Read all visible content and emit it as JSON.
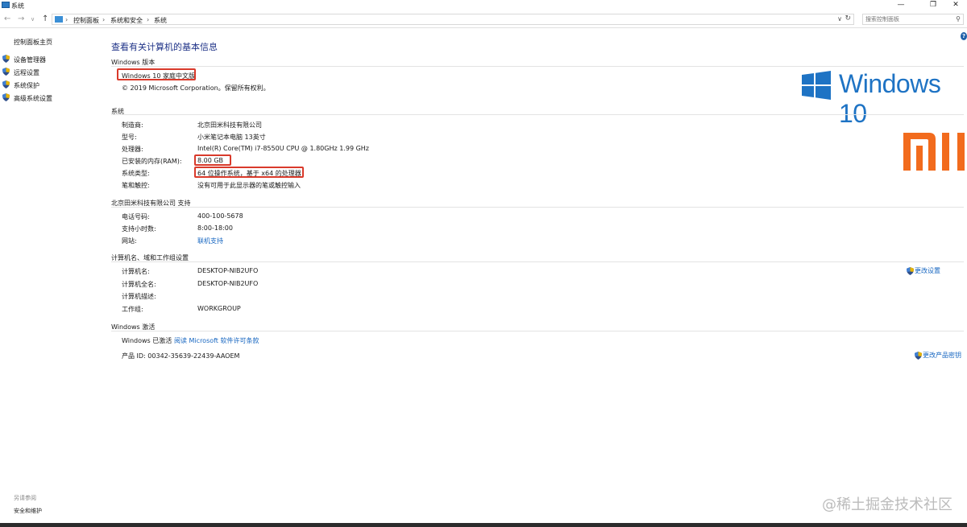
{
  "window": {
    "title": "系统",
    "controls": {
      "minimize": "—",
      "maximize": "❐",
      "close": "✕"
    }
  },
  "address": {
    "back": "←",
    "forward": "→",
    "dropdown": "∨",
    "up": "↑",
    "crumbs": [
      "控制面板",
      "系统和安全",
      "系统"
    ],
    "separator": "›",
    "refresh": "↻",
    "search_placeholder": "搜索控制面板",
    "search_icon_glyph": "⚲"
  },
  "sidebar": {
    "home": "控制面板主页",
    "items": [
      "设备管理器",
      "远程设置",
      "系统保护",
      "高级系统设置"
    ],
    "see_also": "另请参阅",
    "security": "安全和维护"
  },
  "main": {
    "title": "查看有关计算机的基本信息",
    "help_glyph": "?",
    "edition": {
      "header": "Windows 版本",
      "name": "Windows 10 家庭中文版",
      "copyright": "© 2019 Microsoft Corporation。保留所有权利。",
      "logo_text": "Windows 10"
    },
    "system": {
      "header": "系统",
      "rows": [
        {
          "key": "制造商:",
          "value": "北京田米科技有限公司"
        },
        {
          "key": "型号:",
          "value": "小米笔记本电脑 13英寸"
        },
        {
          "key": "处理器:",
          "value": "Intel(R) Core(TM) i7-8550U CPU @ 1.80GHz   1.99 GHz"
        },
        {
          "key": "已安装的内存(RAM):",
          "value": "8.00 GB"
        },
        {
          "key": "系统类型:",
          "value": "64 位操作系统，基于 x64 的处理器"
        },
        {
          "key": "笔和触控:",
          "value": "没有可用于此显示器的笔或触控输入"
        }
      ]
    },
    "support": {
      "header": "北京田米科技有限公司 支持",
      "rows": [
        {
          "key": "电话号码:",
          "value": "400-100-5678"
        },
        {
          "key": "支持小时数:",
          "value": "8:00-18:00"
        },
        {
          "key": "网站:",
          "value": "联机支持"
        }
      ]
    },
    "computer": {
      "header": "计算机名、域和工作组设置",
      "change_settings": "更改设置",
      "rows": [
        {
          "key": "计算机名:",
          "value": "DESKTOP-NIB2UFO"
        },
        {
          "key": "计算机全名:",
          "value": "DESKTOP-NIB2UFO"
        },
        {
          "key": "计算机描述:",
          "value": ""
        },
        {
          "key": "工作组:",
          "value": "WORKGROUP"
        }
      ]
    },
    "activation": {
      "header": "Windows 激活",
      "status": "Windows 已激活",
      "license_link": "阅读 Microsoft 软件许可条款",
      "product_id": "产品 ID: 00342-35639-22439-AAOEM",
      "change_key": "更改产品密钥"
    }
  },
  "watermark": "@稀土掘金技术社区",
  "colors": {
    "accent": "#1e73c4",
    "highlight": "#d93a2b",
    "xiaomi": "#f26b1d",
    "title": "#1e3287"
  }
}
